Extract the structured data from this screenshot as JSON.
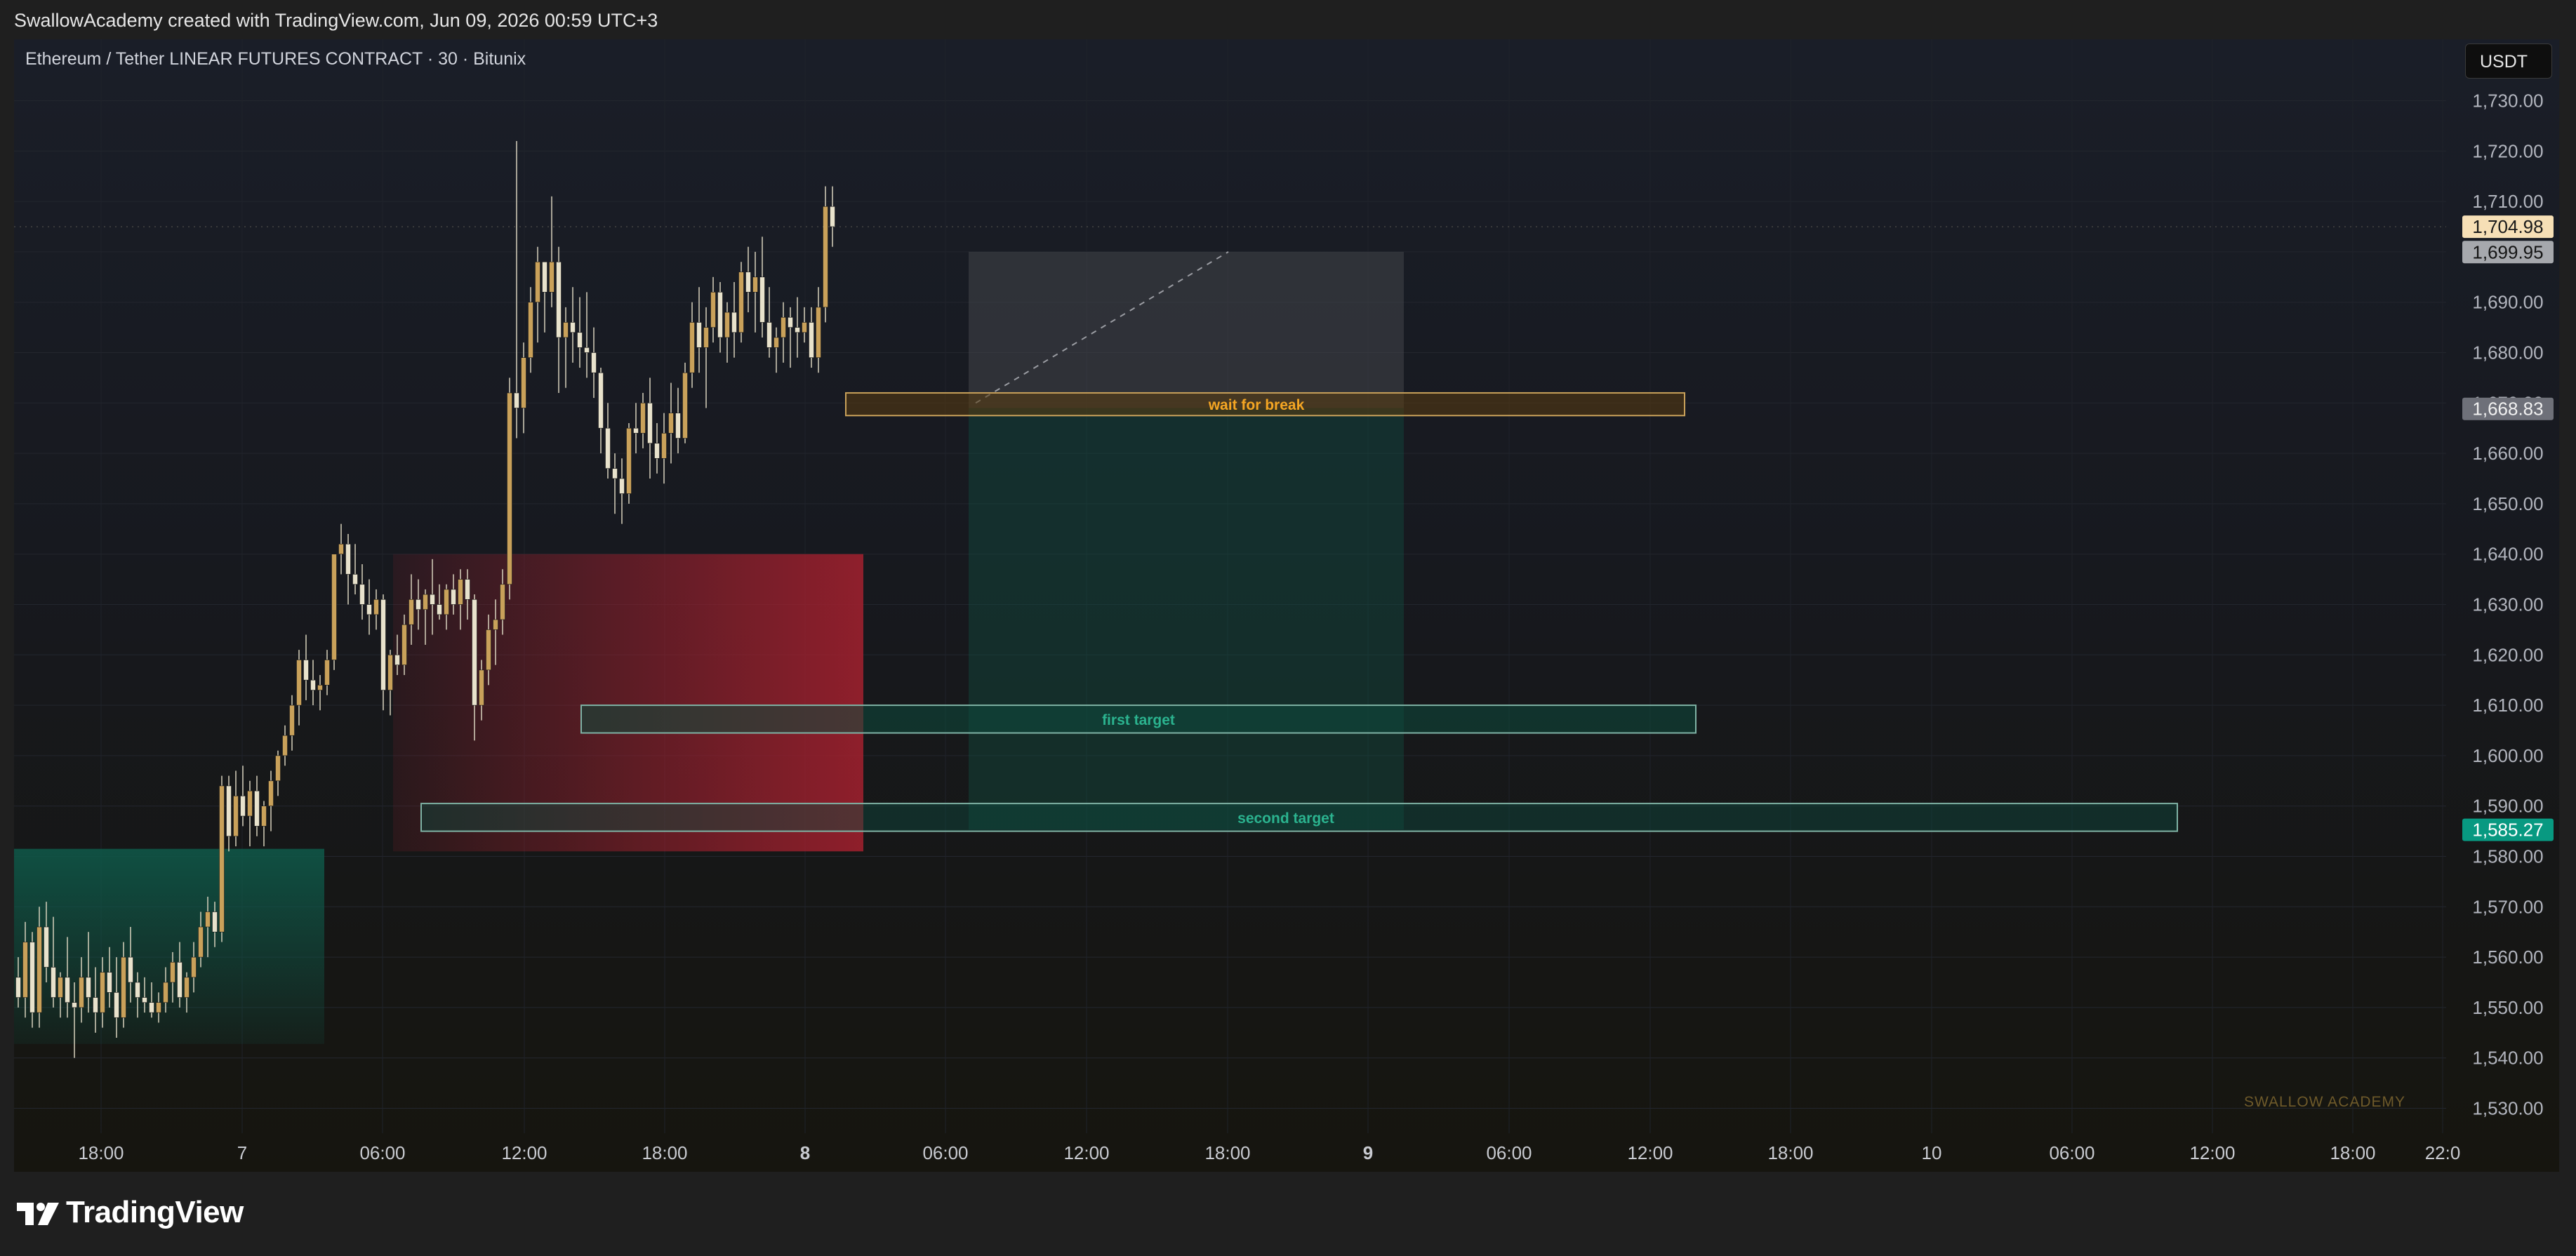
{
  "header": {
    "attribution": "SwallowAcademy created with TradingView.com, Jun 09, 2026 00:59 UTC+3"
  },
  "chart": {
    "symbol_title": "Ethereum / Tether LINEAR FUTURES CONTRACT · 30 · Bitunix",
    "currency": "USDT",
    "watermark": "SWALLOW ACADEMY"
  },
  "footer": {
    "logo_text": "TradingView"
  },
  "colors": {
    "bull_candle": "#c9a15a",
    "bear_candle": "#e8e2cc",
    "wick": "#d8d2bd",
    "demand_zone": "#0e5a4a",
    "supply_zone": "#a3202e",
    "target_label": "#2bb38f",
    "break_label": "#f5a623",
    "price_last": "#f6dfb6",
    "price_green": "#089981"
  },
  "chart_data": {
    "type": "candlestick",
    "timeframe": "30",
    "x_tick_labels": [
      "18:00",
      "7",
      "06:00",
      "12:00",
      "18:00",
      "8",
      "06:00",
      "12:00",
      "18:00",
      "9",
      "06:00",
      "12:00",
      "18:00",
      "10",
      "06:00",
      "12:00",
      "18:00",
      "22:0"
    ],
    "y_tick_labels": [
      "1,730.00",
      "1,720.00",
      "1,710.00",
      "1,700.00",
      "1,690.00",
      "1,680.00",
      "1,670.00",
      "1,660.00",
      "1,650.00",
      "1,640.00",
      "1,630.00",
      "1,620.00",
      "1,610.00",
      "1,600.00",
      "1,590.00",
      "1,580.00",
      "1,570.00",
      "1,560.00",
      "1,550.00",
      "1,540.00",
      "1,530.00"
    ],
    "ylim": [
      1527,
      1735
    ],
    "price_labels": [
      {
        "value": 1704.98,
        "text": "1,704.98",
        "kind": "last"
      },
      {
        "value": 1699.95,
        "text": "1,699.95",
        "kind": "grey"
      },
      {
        "value": 1668.83,
        "text": "1,668.83",
        "kind": "dark"
      },
      {
        "value": 1585.27,
        "text": "1,585.27",
        "kind": "green"
      }
    ],
    "annotations": [
      {
        "text": "wait for break",
        "from_price": 1672.0,
        "to_price": 1667.5
      },
      {
        "text": "first target",
        "from_price": 1610.0,
        "to_price": 1604.5
      },
      {
        "text": "second target",
        "from_price": 1590.5,
        "to_price": 1585.0
      }
    ],
    "ohlc": [
      [
        1556,
        1560,
        1550,
        1552
      ],
      [
        1552,
        1567,
        1548,
        1563
      ],
      [
        1563,
        1565,
        1546,
        1549
      ],
      [
        1549,
        1570,
        1546,
        1566
      ],
      [
        1566,
        1571,
        1555,
        1558
      ],
      [
        1558,
        1568,
        1550,
        1552
      ],
      [
        1552,
        1557,
        1548,
        1556
      ],
      [
        1556,
        1564,
        1548,
        1551
      ],
      [
        1551,
        1555,
        1540,
        1550
      ],
      [
        1550,
        1560,
        1547,
        1556
      ],
      [
        1556,
        1565,
        1549,
        1552
      ],
      [
        1552,
        1558,
        1545,
        1549
      ],
      [
        1549,
        1560,
        1546,
        1557
      ],
      [
        1557,
        1562,
        1550,
        1553
      ],
      [
        1553,
        1560,
        1544,
        1548
      ],
      [
        1548,
        1563,
        1546,
        1560
      ],
      [
        1560,
        1566,
        1551,
        1555
      ],
      [
        1555,
        1557,
        1548,
        1552
      ],
      [
        1552,
        1556,
        1549,
        1551
      ],
      [
        1551,
        1555,
        1548,
        1549
      ],
      [
        1549,
        1553,
        1547,
        1551
      ],
      [
        1551,
        1558,
        1549,
        1555
      ],
      [
        1555,
        1561,
        1551,
        1559
      ],
      [
        1559,
        1563,
        1550,
        1552
      ],
      [
        1552,
        1557,
        1549,
        1556
      ],
      [
        1556,
        1563,
        1553,
        1560
      ],
      [
        1560,
        1569,
        1558,
        1566
      ],
      [
        1566,
        1572,
        1560,
        1569
      ],
      [
        1569,
        1571,
        1562,
        1565
      ],
      [
        1565,
        1596,
        1563,
        1594
      ],
      [
        1594,
        1596,
        1581,
        1584
      ],
      [
        1584,
        1597,
        1582,
        1592
      ],
      [
        1592,
        1598,
        1586,
        1588
      ],
      [
        1588,
        1595,
        1582,
        1593
      ],
      [
        1593,
        1596,
        1584,
        1586
      ],
      [
        1586,
        1591,
        1582,
        1590
      ],
      [
        1590,
        1597,
        1585,
        1595
      ],
      [
        1595,
        1601,
        1592,
        1600
      ],
      [
        1600,
        1606,
        1598,
        1604
      ],
      [
        1604,
        1612,
        1601,
        1610
      ],
      [
        1610,
        1621,
        1606,
        1619
      ],
      [
        1619,
        1624,
        1611,
        1615
      ],
      [
        1615,
        1619,
        1610,
        1613
      ],
      [
        1613,
        1616,
        1609,
        1614
      ],
      [
        1614,
        1621,
        1612,
        1619
      ],
      [
        1619,
        1640,
        1617,
        1640
      ],
      [
        1640,
        1646,
        1636,
        1642
      ],
      [
        1642,
        1644,
        1630,
        1636
      ],
      [
        1636,
        1642,
        1632,
        1634
      ],
      [
        1634,
        1638,
        1627,
        1630
      ],
      [
        1630,
        1635,
        1624,
        1628
      ],
      [
        1628,
        1633,
        1625,
        1631
      ],
      [
        1631,
        1632,
        1609,
        1613
      ],
      [
        1613,
        1621,
        1608,
        1620
      ],
      [
        1620,
        1624,
        1616,
        1618
      ],
      [
        1618,
        1628,
        1616,
        1626
      ],
      [
        1626,
        1636,
        1622,
        1631
      ],
      [
        1631,
        1635,
        1625,
        1629
      ],
      [
        1629,
        1633,
        1622,
        1632
      ],
      [
        1632,
        1639,
        1624,
        1630
      ],
      [
        1630,
        1634,
        1627,
        1628
      ],
      [
        1628,
        1634,
        1625,
        1633
      ],
      [
        1633,
        1636,
        1628,
        1630
      ],
      [
        1630,
        1637,
        1625,
        1635
      ],
      [
        1635,
        1637,
        1627,
        1631
      ],
      [
        1631,
        1632,
        1603,
        1610
      ],
      [
        1610,
        1619,
        1607,
        1617
      ],
      [
        1617,
        1628,
        1614,
        1625
      ],
      [
        1625,
        1631,
        1618,
        1627
      ],
      [
        1627,
        1637,
        1624,
        1634
      ],
      [
        1634,
        1675,
        1631,
        1672
      ],
      [
        1672,
        1722,
        1663,
        1669
      ],
      [
        1669,
        1682,
        1664,
        1679
      ],
      [
        1679,
        1693,
        1676,
        1690
      ],
      [
        1690,
        1701,
        1682,
        1698
      ],
      [
        1698,
        1698,
        1684,
        1692
      ],
      [
        1692,
        1711,
        1689,
        1698
      ],
      [
        1698,
        1701,
        1672,
        1683
      ],
      [
        1683,
        1689,
        1673,
        1686
      ],
      [
        1686,
        1693,
        1678,
        1684
      ],
      [
        1684,
        1691,
        1677,
        1681
      ],
      [
        1681,
        1692,
        1675,
        1680
      ],
      [
        1680,
        1685,
        1671,
        1676
      ],
      [
        1676,
        1677,
        1660,
        1665
      ],
      [
        1665,
        1670,
        1655,
        1657
      ],
      [
        1657,
        1660,
        1648,
        1655
      ],
      [
        1655,
        1659,
        1646,
        1652
      ],
      [
        1652,
        1666,
        1650,
        1665
      ],
      [
        1665,
        1670,
        1660,
        1664
      ],
      [
        1664,
        1672,
        1661,
        1670
      ],
      [
        1670,
        1675,
        1655,
        1662
      ],
      [
        1662,
        1666,
        1656,
        1659
      ],
      [
        1659,
        1668,
        1654,
        1664
      ],
      [
        1664,
        1674,
        1658,
        1668
      ],
      [
        1668,
        1673,
        1660,
        1663
      ],
      [
        1663,
        1678,
        1662,
        1676
      ],
      [
        1676,
        1690,
        1673,
        1686
      ],
      [
        1686,
        1693,
        1676,
        1681
      ],
      [
        1681,
        1689,
        1669,
        1685
      ],
      [
        1685,
        1695,
        1682,
        1692
      ],
      [
        1692,
        1694,
        1680,
        1683
      ],
      [
        1683,
        1690,
        1678,
        1688
      ],
      [
        1688,
        1694,
        1679,
        1684
      ],
      [
        1684,
        1698,
        1682,
        1696
      ],
      [
        1696,
        1701,
        1688,
        1692
      ],
      [
        1692,
        1700,
        1684,
        1695
      ],
      [
        1695,
        1703,
        1683,
        1686
      ],
      [
        1686,
        1693,
        1679,
        1681
      ],
      [
        1681,
        1685,
        1676,
        1683
      ],
      [
        1683,
        1690,
        1678,
        1687
      ],
      [
        1687,
        1689,
        1677,
        1685
      ],
      [
        1685,
        1691,
        1679,
        1684
      ],
      [
        1684,
        1689,
        1682,
        1686
      ],
      [
        1686,
        1689,
        1677,
        1679
      ],
      [
        1679,
        1693,
        1676,
        1689
      ],
      [
        1689,
        1713,
        1686,
        1709
      ],
      [
        1709,
        1713,
        1701,
        1705
      ]
    ]
  }
}
